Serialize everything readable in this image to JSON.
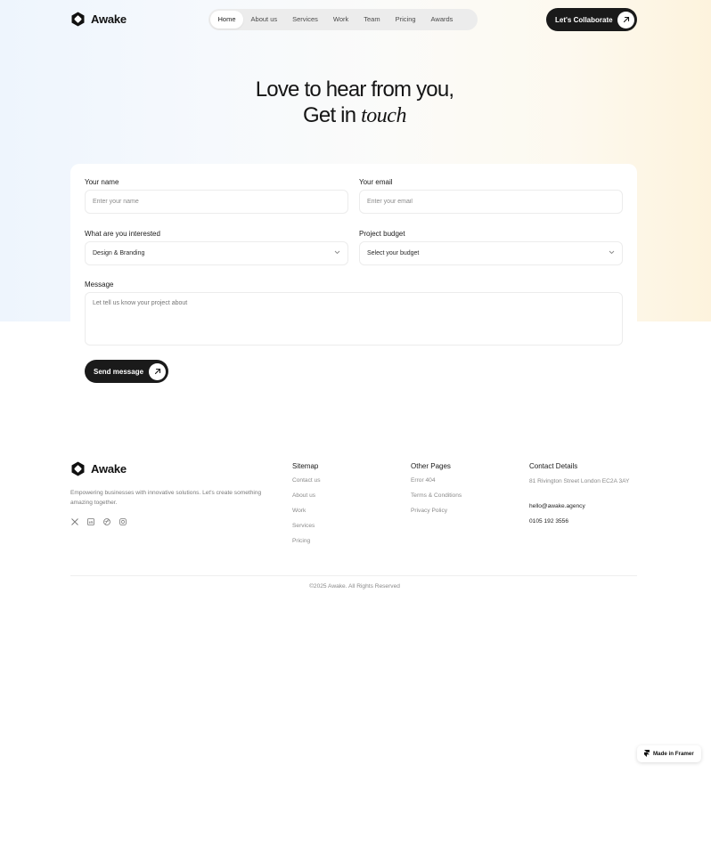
{
  "brand": {
    "name": "Awake"
  },
  "nav": {
    "items": [
      {
        "label": "Home"
      },
      {
        "label": "About us"
      },
      {
        "label": "Services"
      },
      {
        "label": "Work"
      },
      {
        "label": "Team"
      },
      {
        "label": "Pricing"
      },
      {
        "label": "Awards"
      }
    ],
    "active": "Home",
    "cta_label": "Let's Collaborate"
  },
  "hero": {
    "line1": "Love to hear from you,",
    "line2_prefix": "Get in",
    "line2_italic": "touch"
  },
  "form": {
    "name": {
      "label": "Your name",
      "placeholder": "Enter your name"
    },
    "email": {
      "label": "Your email",
      "placeholder": "Enter your email"
    },
    "interest": {
      "label": "What are you interested",
      "value": "Design & Branding"
    },
    "budget": {
      "label": "Project budget",
      "value": "Select your budget"
    },
    "message": {
      "label": "Message",
      "placeholder": "Let tell us know your project about"
    },
    "send_label": "Send message"
  },
  "footer": {
    "description": "Empowering businesses with innovative solutions.  Let's create something amazing together.",
    "socials": [
      "x-icon",
      "linkedin-icon",
      "dribbble-icon",
      "instagram-icon"
    ],
    "sitemap": {
      "title": "Sitemap",
      "links": [
        "Contact us",
        "About us",
        "Work",
        "Services",
        "Pricing"
      ]
    },
    "other": {
      "title": "Other Pages",
      "links": [
        "Error 404",
        "Terms & Conditions",
        "Privacy Policy"
      ]
    },
    "contact": {
      "title": "Contact Details",
      "address": "81 Rivington Street London  EC2A 3AY",
      "email": "hello@awake.agency",
      "phone": "0105 192 3556"
    },
    "copyright": "©2025 Awake. All Rights Reserved"
  },
  "badge": {
    "label": "Made in Framer"
  },
  "colors": {
    "primary": "#1a1a1a",
    "hero_left": "#eef5fd",
    "hero_right": "#fdf3dd"
  }
}
